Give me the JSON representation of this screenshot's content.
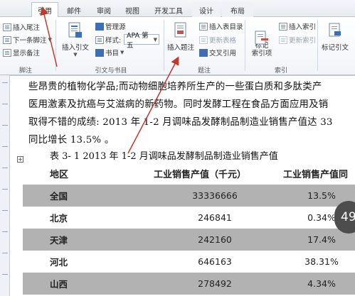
{
  "tabs": [
    "引用",
    "邮件",
    "审阅",
    "视图",
    "开发工具",
    "设计",
    "布局"
  ],
  "ribbon": {
    "footnote": {
      "insert_endnote": "插入尾注",
      "next_footnote": "下一条脚注",
      "show_notes": "显示备注",
      "group_label": "脚注"
    },
    "citations": {
      "insert_citation": "插入引文",
      "manage_sources": "管理源",
      "style_label": "样式:",
      "style_value": "APA 第五",
      "bibliography": "书目",
      "group_label": "引文与书目"
    },
    "captions": {
      "insert_caption": "插入题注",
      "insert_toc_figures": "插入表目录",
      "update_table": "更新表格",
      "cross_reference": "交叉引用",
      "group_label": "题注"
    },
    "index": {
      "mark_entry": "标记\n索引项",
      "insert_index": "插入索引",
      "update_index": "更新索引",
      "group_label": "索引"
    },
    "toa": {
      "mark_citation": "标记引文"
    }
  },
  "document": {
    "lines": [
      "些昂贵的植物化学品;而动物细胞培养所生产的一些蛋白质和多肽类产",
      "医用激素及抗癌与艾滋病的新药物。同时发酵工程在食品方面应用及销",
      "取得不错的成绩: 2013 年 1-2 月调味品发酵制品制造业销售产值达 33",
      "同比增长 13.5% 。"
    ],
    "caption": "表 3- 1    2013 年 1-2 月调味品发酵制品制造业销售产值",
    "table_handle": "+",
    "table": {
      "headers": [
        "地区",
        "工业销售产值（千元）",
        "工业销售产值同"
      ],
      "rows": [
        [
          "全国",
          "33336666",
          "13.5%"
        ],
        [
          "北京",
          "246841",
          "0.34%"
        ],
        [
          "天津",
          "242160",
          "17.4%"
        ],
        [
          "河北",
          "646163",
          "38.31%"
        ],
        [
          "山西",
          "278492",
          "4.34%"
        ]
      ]
    }
  },
  "page_badge": "49"
}
